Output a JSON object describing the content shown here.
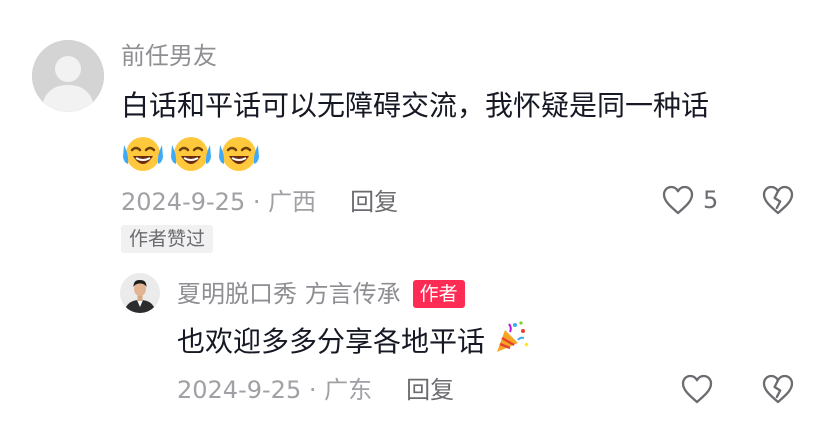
{
  "main_comment": {
    "username": "前任男友",
    "text": "白话和平话可以无障碍交流，我怀疑是同一种话",
    "emojis": [
      "laugh-cry-icon",
      "laugh-cry-icon",
      "laugh-cry-icon"
    ],
    "date_location": "2024-9-25 · 广西",
    "reply_label": "回复",
    "like_count": "5",
    "author_liked_badge": "作者赞过"
  },
  "reply_comment": {
    "username": "夏明脱口秀 方言传承",
    "author_tag": "作者",
    "text": "也欢迎多多分享各地平话",
    "emoji": "party-popper-icon",
    "date_location": "2024-9-25 · 广东",
    "reply_label": "回复"
  },
  "colors": {
    "text_primary": "#161823",
    "text_secondary": "#8e8e93",
    "author_tag_bg": "#fe2c55",
    "badge_bg": "#f1f1f2"
  }
}
